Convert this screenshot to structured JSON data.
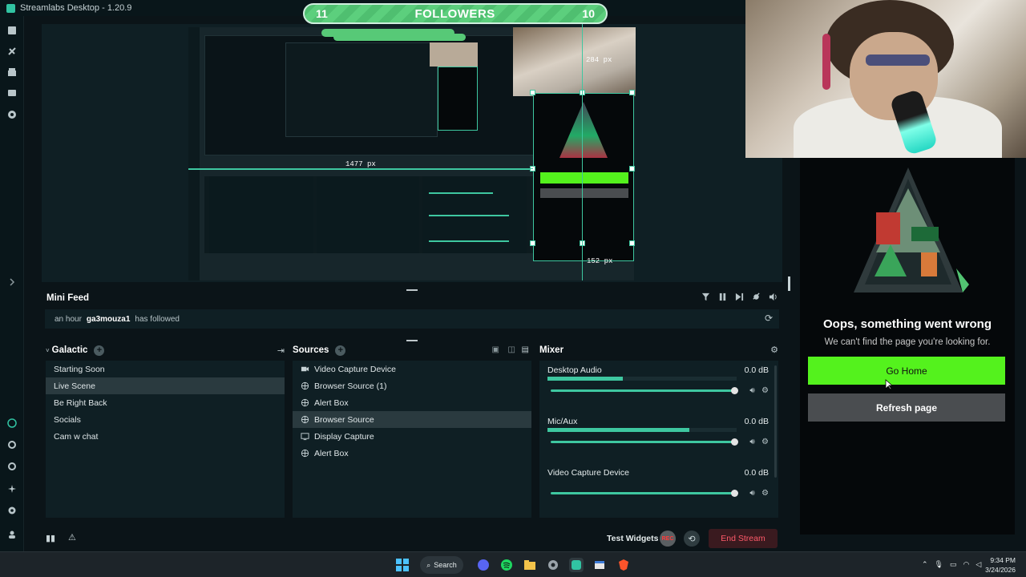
{
  "window": {
    "title": "Streamlabs Desktop - 1.20.9"
  },
  "followers_goal": {
    "left_value": "11",
    "label": "FOLLOWERS",
    "right_value": "10"
  },
  "preview": {
    "width_label": "1477 px",
    "height_label_top": "284 px",
    "height_label_bottom": "152 px"
  },
  "error_page": {
    "title": "Oops, something went wrong",
    "subtitle": "We can't find the page you're looking for.",
    "home_button": "Go Home",
    "refresh_button": "Refresh page"
  },
  "mini_feed": {
    "title": "Mini Feed",
    "events": [
      {
        "time": "an hour",
        "user": "ga3mouza1",
        "action": "has followed"
      }
    ]
  },
  "scenes": {
    "title": "Galactic",
    "items": [
      {
        "label": "Starting Soon",
        "active": false
      },
      {
        "label": "Live Scene",
        "active": true
      },
      {
        "label": "Be Right Back",
        "active": false
      },
      {
        "label": "Socials",
        "active": false
      },
      {
        "label": "Cam w chat",
        "active": false
      }
    ]
  },
  "sources": {
    "title": "Sources",
    "items": [
      {
        "label": "Video Capture Device",
        "icon": "camera-icon",
        "active": false
      },
      {
        "label": "Browser Source (1)",
        "icon": "globe-icon",
        "active": false
      },
      {
        "label": "Alert Box",
        "icon": "globe-icon",
        "active": false
      },
      {
        "label": "Browser Source",
        "icon": "globe-icon",
        "active": true
      },
      {
        "label": "Display Capture",
        "icon": "monitor-icon",
        "active": false
      },
      {
        "label": "Alert Box",
        "icon": "globe-icon",
        "active": false
      }
    ]
  },
  "mixer": {
    "title": "Mixer",
    "channels": [
      {
        "name": "Desktop Audio",
        "db": "0.0 dB",
        "level": 0.4
      },
      {
        "name": "Mic/Aux",
        "db": "0.0 dB",
        "level": 0.75
      },
      {
        "name": "Video Capture Device",
        "db": "0.0 dB",
        "level": 0
      }
    ]
  },
  "footer": {
    "test_widgets": "Test Widgets",
    "rec_label": "REC",
    "end_stream": "End Stream"
  },
  "taskbar": {
    "search_label": "Search",
    "time": "9:34 PM",
    "date": "3/24/2026"
  },
  "colors": {
    "accent": "#3ec7a0",
    "error_green": "#54f21d",
    "end_stream_text": "#ff5a6a"
  }
}
